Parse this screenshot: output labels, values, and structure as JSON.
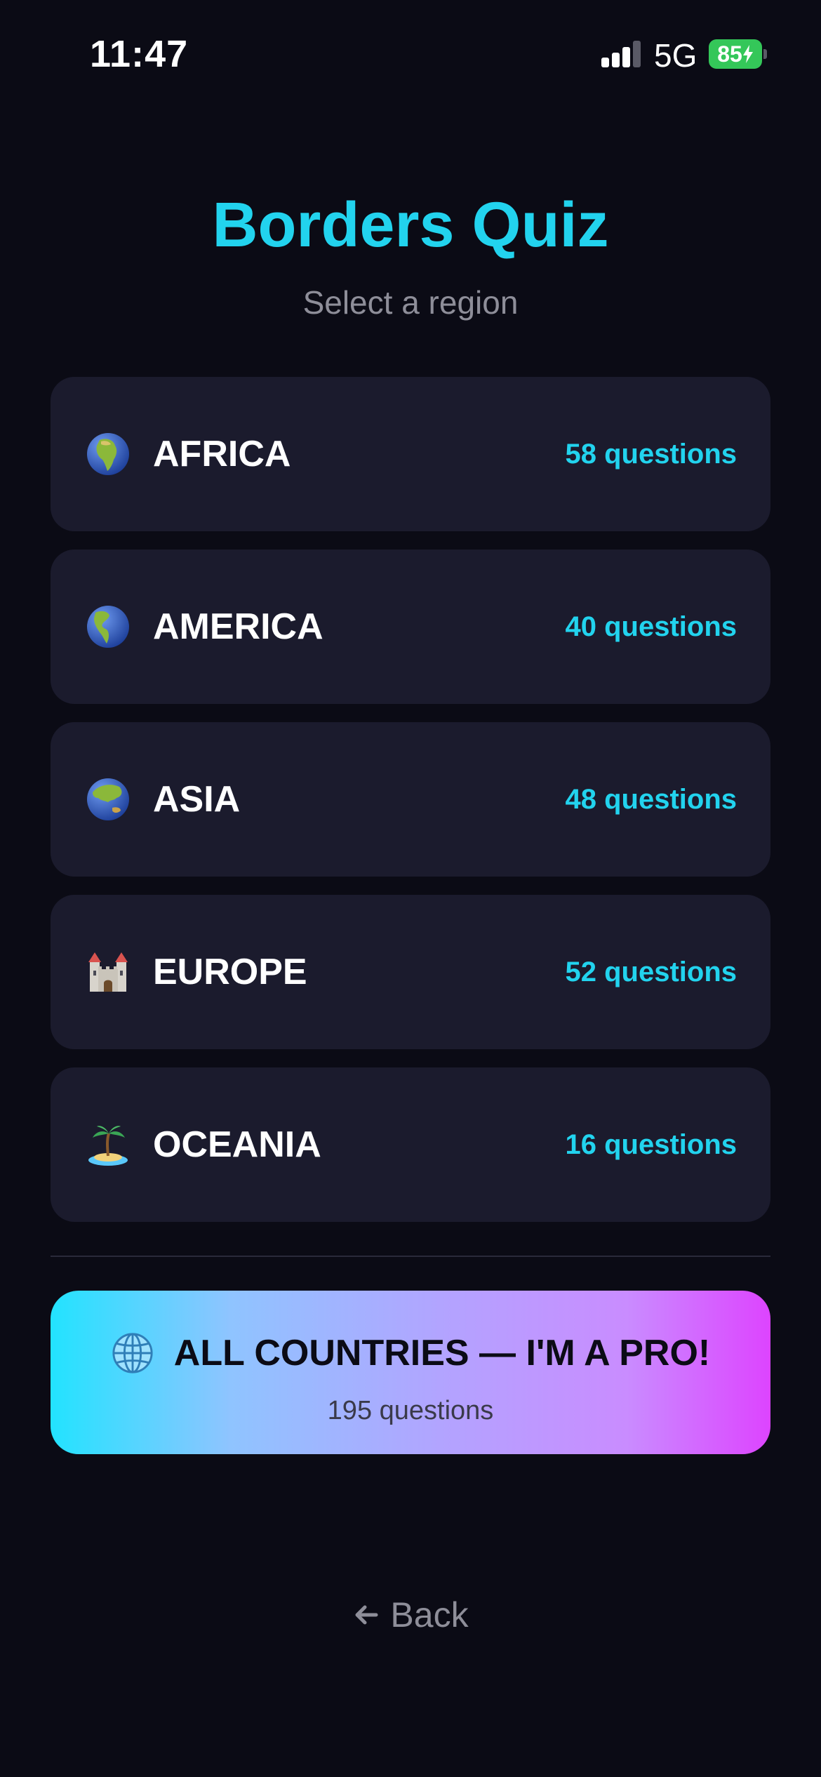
{
  "status_bar": {
    "time": "11:47",
    "network": "5G",
    "battery": "85"
  },
  "header": {
    "title": "Borders Quiz",
    "subtitle": "Select a region"
  },
  "regions": [
    {
      "icon": "globe-africa-icon",
      "name": "AFRICA",
      "count": "58 questions"
    },
    {
      "icon": "globe-americas-icon",
      "name": "AMERICA",
      "count": "40 questions"
    },
    {
      "icon": "globe-asia-icon",
      "name": "ASIA",
      "count": "48 questions"
    },
    {
      "icon": "castle-icon",
      "name": "EUROPE",
      "count": "52 questions"
    },
    {
      "icon": "island-icon",
      "name": "OCEANIA",
      "count": "16 questions"
    }
  ],
  "pro_mode": {
    "icon": "globe-meridians-icon",
    "label": "ALL COUNTRIES — I'M A PRO!",
    "count": "195 questions"
  },
  "back": {
    "icon": "arrow-left-icon",
    "label": "Back"
  },
  "colors": {
    "background": "#0b0b15",
    "card": "#1b1b2d",
    "accent": "#22d3ee",
    "muted": "#8e8e99",
    "gradient_start": "#22e3ff",
    "gradient_end": "#dd44ff"
  }
}
